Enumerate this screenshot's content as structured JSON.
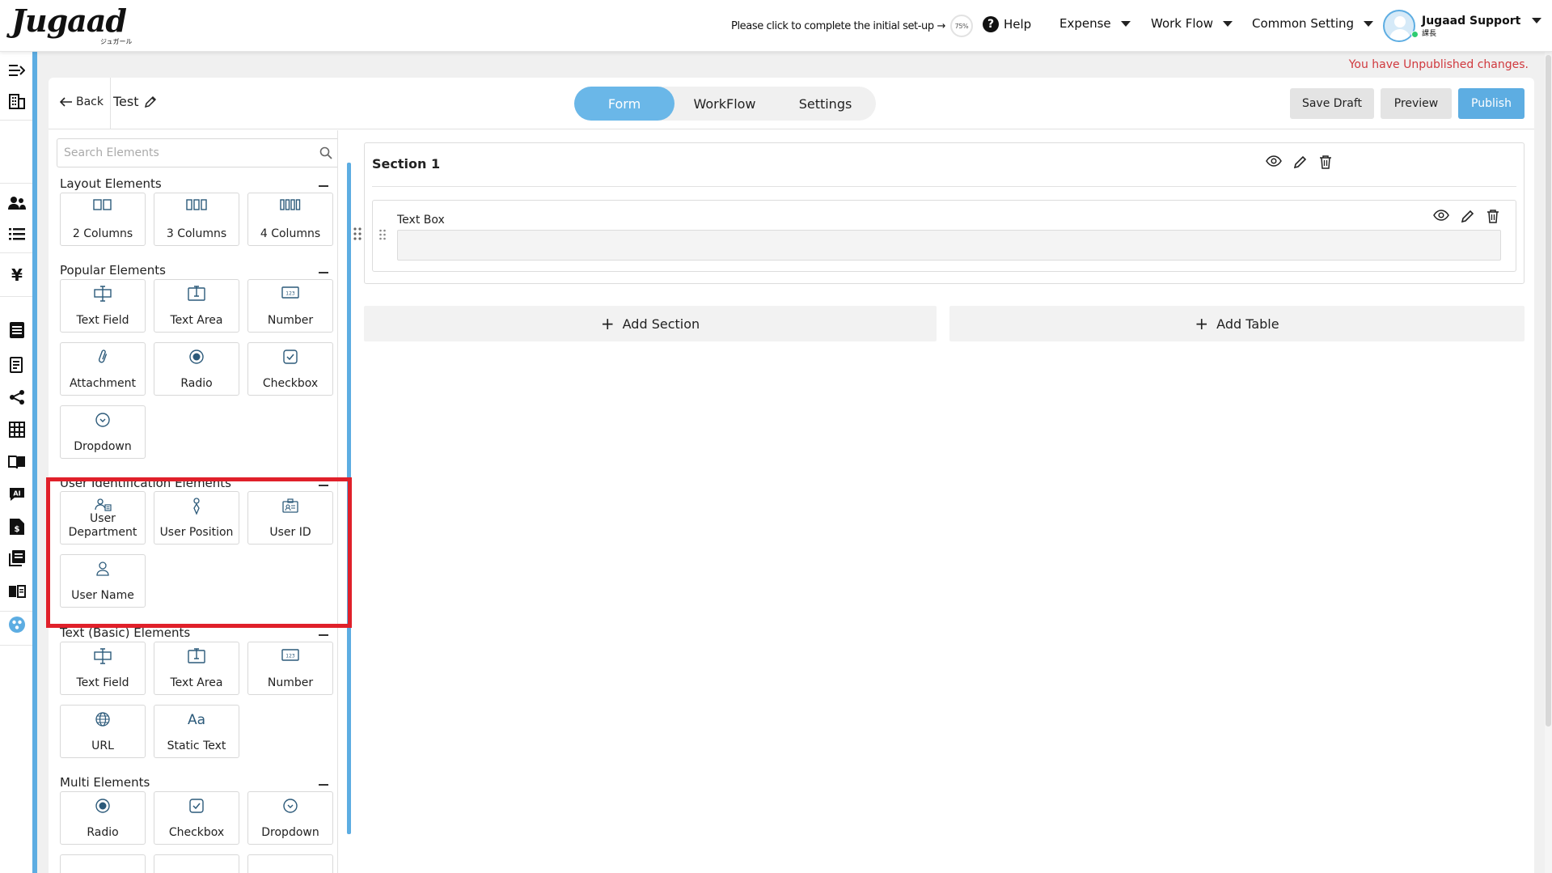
{
  "header": {
    "logo_text": "Jugaad",
    "logo_sub": "ジュガール",
    "setup_text": "Please click to complete the initial set-up →",
    "setup_percent": "75%",
    "help": "Help",
    "nav": [
      "Expense",
      "Work Flow",
      "Common Setting"
    ],
    "user_name": "Jugaad Support",
    "user_role": "課長"
  },
  "status": {
    "unpublished": "You have Unpublished changes."
  },
  "form": {
    "back": "Back",
    "title": "Test",
    "tabs": [
      "Form",
      "WorkFlow",
      "Settings"
    ],
    "active_tab": "Form",
    "buttons": {
      "save_draft": "Save Draft",
      "preview": "Preview",
      "publish": "Publish"
    }
  },
  "palette": {
    "search_placeholder": "Search Elements",
    "groups": [
      {
        "title": "Layout Elements",
        "items": [
          {
            "label": "2 Columns",
            "icon": "two-columns-icon"
          },
          {
            "label": "3 Columns",
            "icon": "three-columns-icon"
          },
          {
            "label": "4 Columns",
            "icon": "four-columns-icon"
          }
        ]
      },
      {
        "title": "Popular Elements",
        "items": [
          {
            "label": "Text Field",
            "icon": "text-field-icon"
          },
          {
            "label": "Text Area",
            "icon": "text-area-icon"
          },
          {
            "label": "Number",
            "icon": "number-icon"
          },
          {
            "label": "Attachment",
            "icon": "paperclip-icon"
          },
          {
            "label": "Radio",
            "icon": "radio-icon"
          },
          {
            "label": "Checkbox",
            "icon": "checkbox-icon"
          },
          {
            "label": "Dropdown",
            "icon": "dropdown-icon"
          }
        ]
      },
      {
        "title": "User Identification Elements",
        "items": [
          {
            "label": "User Department",
            "icon": "user-department-icon"
          },
          {
            "label": "User Position",
            "icon": "user-position-icon"
          },
          {
            "label": "User ID",
            "icon": "user-id-icon"
          },
          {
            "label": "User Name",
            "icon": "user-name-icon"
          }
        ]
      },
      {
        "title": "Text (Basic) Elements",
        "items": [
          {
            "label": "Text Field",
            "icon": "text-field-icon"
          },
          {
            "label": "Text Area",
            "icon": "text-area-icon"
          },
          {
            "label": "Number",
            "icon": "number-icon"
          },
          {
            "label": "URL",
            "icon": "globe-icon"
          },
          {
            "label": "Static Text",
            "icon": "static-text-icon"
          }
        ]
      },
      {
        "title": "Multi Elements",
        "items": [
          {
            "label": "Radio",
            "icon": "radio-icon"
          },
          {
            "label": "Checkbox",
            "icon": "checkbox-icon"
          },
          {
            "label": "Dropdown",
            "icon": "dropdown-icon"
          }
        ]
      }
    ]
  },
  "builder": {
    "section_title": "Section 1",
    "field_label": "Text Box",
    "add_section": "Add Section",
    "add_table": "Add Table"
  },
  "colors": {
    "accent": "#5dade2",
    "tab_active": "#6ab7e8",
    "warning": "#d0393e",
    "highlight": "#e0202a"
  }
}
